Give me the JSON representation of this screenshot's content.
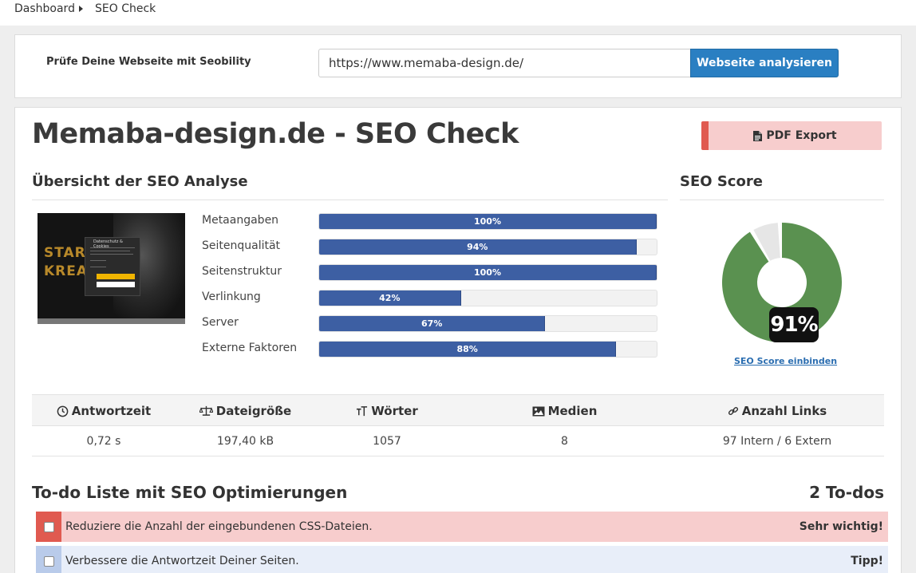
{
  "breadcrumb": {
    "home": "Dashboard",
    "current": "SEO Check"
  },
  "analyzer": {
    "prompt": "Prüfe Deine Webseite mit Seobility",
    "url_value": "https://www.memaba-design.de/",
    "button_label": "Webseite analysieren"
  },
  "page": {
    "title": "Memaba-design.de - SEO Check",
    "pdf_export_label": "PDF Export"
  },
  "overview": {
    "heading": "Übersicht der SEO Analyse",
    "thumbnail": {
      "line1": "STAR",
      "line2": "KREA",
      "dialog_title": "Datenschutz & Cookies"
    },
    "bars": [
      {
        "label": "Metaangaben",
        "percent": 100,
        "display": "100%"
      },
      {
        "label": "Seitenqualität",
        "percent": 94,
        "display": "94%"
      },
      {
        "label": "Seitenstruktur",
        "percent": 100,
        "display": "100%"
      },
      {
        "label": "Verlinkung",
        "percent": 42,
        "display": "42%"
      },
      {
        "label": "Server",
        "percent": 67,
        "display": "67%"
      },
      {
        "label": "Externe Faktoren",
        "percent": 88,
        "display": "88%"
      }
    ]
  },
  "score": {
    "heading": "SEO Score",
    "value": 91,
    "display": "91%",
    "embed_link": "SEO Score einbinden",
    "colors": {
      "filled": "#5a9150",
      "empty": "#e6e6e6"
    }
  },
  "stats": {
    "columns": [
      {
        "icon": "clock-icon",
        "label": "Antwortzeit",
        "value": "0,72 s"
      },
      {
        "icon": "scale-icon",
        "label": "Dateigröße",
        "value": "197,40 kB"
      },
      {
        "icon": "text-size-icon",
        "label": "Wörter",
        "value": "1057"
      },
      {
        "icon": "image-icon",
        "label": "Medien",
        "value": "8"
      },
      {
        "icon": "link-icon",
        "label": "Anzahl Links",
        "value": "97 Intern / 6 Extern"
      }
    ]
  },
  "todo": {
    "heading": "To-do Liste mit SEO Optimierungen",
    "count_label": "2 To-dos",
    "items": [
      {
        "text": "Reduziere die Anzahl der eingebundenen CSS-Dateien.",
        "priority": "Sehr wichtig!",
        "accent": "#e05a50",
        "background": "#f7cdcd"
      },
      {
        "text": "Verbessere die Antwortzeit Deiner Seiten.",
        "priority": "Tipp!",
        "accent": "#b9cbea",
        "background": "#e8eef9"
      }
    ]
  },
  "colors": {
    "primary_button": "#2a7fc2",
    "bar_fill": "#3d5fa3",
    "danger": "#e05a50"
  }
}
